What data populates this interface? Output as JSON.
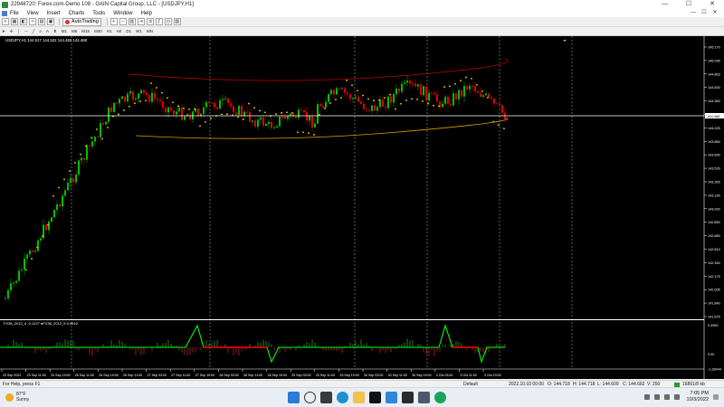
{
  "window": {
    "title": "22948720: Forex.com-Demo 108 - GAIN Capital Group, LLC - [USDJPY,H1]",
    "controls": [
      "—",
      "☐",
      "✕"
    ]
  },
  "menu": {
    "items": [
      "File",
      "View",
      "Insert",
      "Charts",
      "Tools",
      "Window",
      "Help"
    ],
    "mdi_controls": [
      "—",
      "☐",
      "✕"
    ]
  },
  "toolbar": {
    "autotrading_label": "AutoTrading",
    "timeframes": [
      "M1",
      "M5",
      "M15",
      "M30",
      "H1",
      "H4",
      "D1",
      "W1",
      "MN"
    ]
  },
  "chart": {
    "header": "USDJPY,H1  144.517 144.522 144.482 144.488",
    "indicator_header": "FX38_2012_4 -0.1227  ●FX38_2012_5 0.0610",
    "current_price": "144.488",
    "price_ticks": [
      "145.170",
      "145.035",
      "144.863",
      "144.530",
      "144.360",
      "144.190",
      "144.025",
      "143.860",
      "143.690",
      "143.520",
      "143.355",
      "143.190",
      "143.020",
      "142.850",
      "142.680",
      "142.510",
      "142.340",
      "142.175",
      "142.005",
      "141.840",
      "141.675"
    ],
    "indicator_ticks": [
      "2.4952",
      "0.00",
      "-1.28444"
    ],
    "time_ticks": [
      "23 Sep 2022",
      "23 Sep 11:00",
      "23 Sep 19:00",
      "26 Sep 11:00",
      "26 Sep 19:00",
      "26 Sep 11:00",
      "27 Sep 03:00",
      "27 Sep 11:00",
      "27 Sep 19:00",
      "28 Sep 03:00",
      "28 Sep 11:00",
      "28 Sep 19:00",
      "29 Sep 03:00",
      "29 Sep 11:00",
      "29 Sep 19:00",
      "30 Sep 03:00",
      "30 Sep 11:00",
      "30 Sep 19:00",
      "3 Oct 03:00",
      "3 Oct 11:00",
      "3 Oct 19:00"
    ],
    "colors": {
      "background": "#000000",
      "bull": "#00c000",
      "bear": "#e00000",
      "sar": "#ffd700",
      "upper_band": "#c00000",
      "lower_band": "#e0a000",
      "indicator_green": "#00ff00",
      "indicator_red": "#ff0000"
    }
  },
  "status": {
    "help": "For Help, press F1",
    "profile": "Default",
    "datetime": "2022.10.03 00:00",
    "open": "O: 144.718",
    "high": "H: 144.718",
    "low": "L: 144.609",
    "close": "C: 144.662",
    "volume": "V: 250",
    "traffic": "16861/8 kb"
  },
  "taskbar": {
    "weather_temp": "87°F",
    "weather_desc": "Sunny",
    "time": "7:05 PM",
    "date": "10/3/2022"
  }
}
